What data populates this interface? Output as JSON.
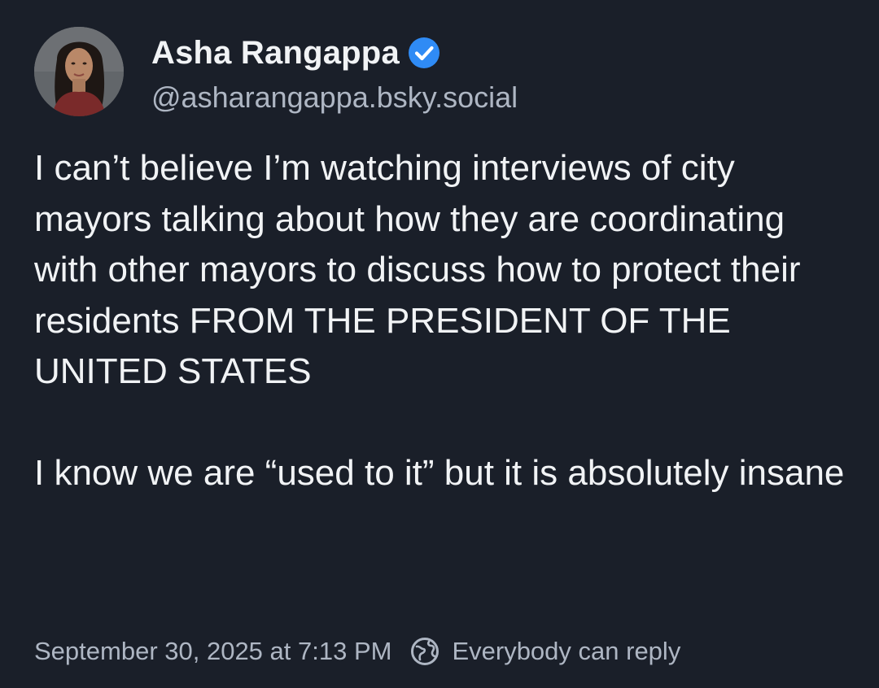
{
  "post": {
    "author": {
      "display_name": "Asha Rangappa",
      "handle": "@asharangappa.bsky.social",
      "verified": true,
      "verified_icon": "verified-check-icon"
    },
    "text": {
      "paragraph1": "I can’t believe I’m watching interviews of city mayors talking about how they are coordinating with other mayors to discuss how to protect their residents FROM THE PRESIDENT OF THE UNITED STATES",
      "paragraph2": "I know we are “used to it” but it is absolutely insane"
    },
    "timestamp": "September 30, 2025 at 7:13 PM",
    "reply_setting": {
      "icon": "globe-icon",
      "label": "Everybody can reply"
    }
  },
  "colors": {
    "background": "#1a1f29",
    "text_primary": "#f1f3f5",
    "text_secondary": "#aeb6c3",
    "verified_badge": "#2f8bf5"
  }
}
